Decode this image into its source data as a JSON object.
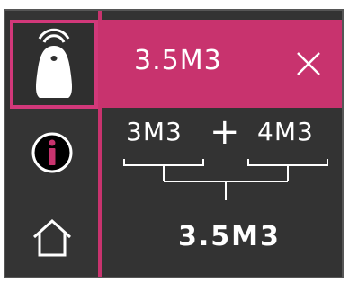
{
  "sidebar": {
    "items": [
      {
        "name": "tool-icon",
        "active": true
      },
      {
        "name": "info-icon",
        "active": false
      },
      {
        "name": "home-icon",
        "active": false
      }
    ]
  },
  "header": {
    "title": "3.5M3",
    "close_icon": "close-icon"
  },
  "calculation": {
    "operand_a": "3M3",
    "operator": "+",
    "operand_b": "4M3",
    "result": "3.5M3"
  },
  "colors": {
    "accent": "#c8336e",
    "background": "#333333",
    "text": "#ffffff"
  }
}
